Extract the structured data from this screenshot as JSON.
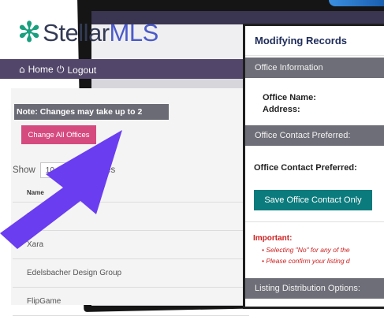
{
  "background_page": {
    "logo": {
      "prefix": "Stellar",
      "suffix": "MLS"
    },
    "nav": {
      "home_label": "Home",
      "logout_label": "Logout"
    },
    "note": "Note: Changes may take up to 2",
    "change_all_button": "Change All Offices",
    "entries": {
      "show_label": "Show",
      "value": "10",
      "suffix": "entries"
    },
    "table": {
      "header": "Name",
      "rows": [
        "ICM",
        "Xara",
        "Edelsbacher Design Group",
        "FlipGame"
      ]
    }
  },
  "modal": {
    "title": "Modifying Records",
    "office_information": {
      "heading": "Office Information",
      "office_name_label": "Office Name:",
      "address_label": "Address:"
    },
    "contact": {
      "heading": "Office Contact Preferred:",
      "label": "Office Contact Preferred:",
      "save_button": "Save Office Contact Only"
    },
    "important": {
      "heading": "Important:",
      "items": [
        "Selecting \"No\" for any of the",
        "Please confirm your listing d"
      ]
    },
    "listing_distribution_heading": "Listing Distribution Options:"
  },
  "colors": {
    "arrow": "#6a3df0",
    "accent_pink": "#d64b7f",
    "save_teal": "#0c7b7d",
    "nav": "#52466a"
  },
  "icons": {
    "home": "home-icon",
    "logout": "power-icon",
    "logo": "snowflake-star-icon"
  }
}
